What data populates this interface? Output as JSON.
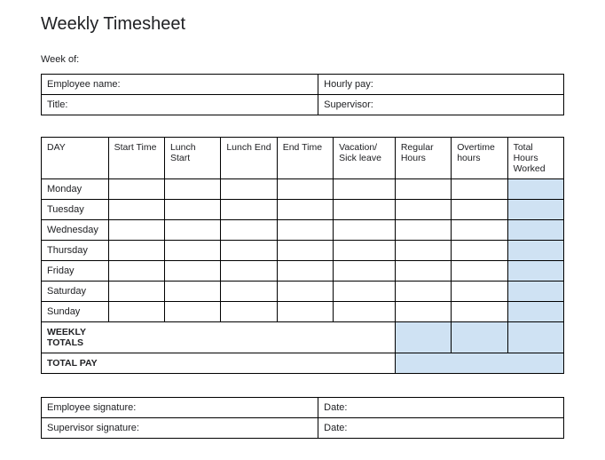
{
  "title": "Weekly Timesheet",
  "week_of_label": "Week of:",
  "info": {
    "employee_name_label": "Employee name:",
    "hourly_pay_label": "Hourly pay:",
    "title_label": "Title:",
    "supervisor_label": "Supervisor:"
  },
  "timesheet": {
    "headers": {
      "day": "DAY",
      "start": "Start Time",
      "lunch_start": "Lunch Start",
      "lunch_end": "Lunch End",
      "end": "End Time",
      "vacation": "Vacation/ Sick leave",
      "regular": "Regular Hours",
      "overtime": "Overtime hours",
      "total": "Total Hours Worked"
    },
    "days": [
      "Monday",
      "Tuesday",
      "Wednesday",
      "Thursday",
      "Friday",
      "Saturday",
      "Sunday"
    ],
    "weekly_totals_label": "WEEKLY TOTALS",
    "total_pay_label": "TOTAL PAY"
  },
  "signatures": {
    "employee_label": "Employee signature:",
    "supervisor_label": "Supervisor signature:",
    "date_label": "Date:"
  }
}
